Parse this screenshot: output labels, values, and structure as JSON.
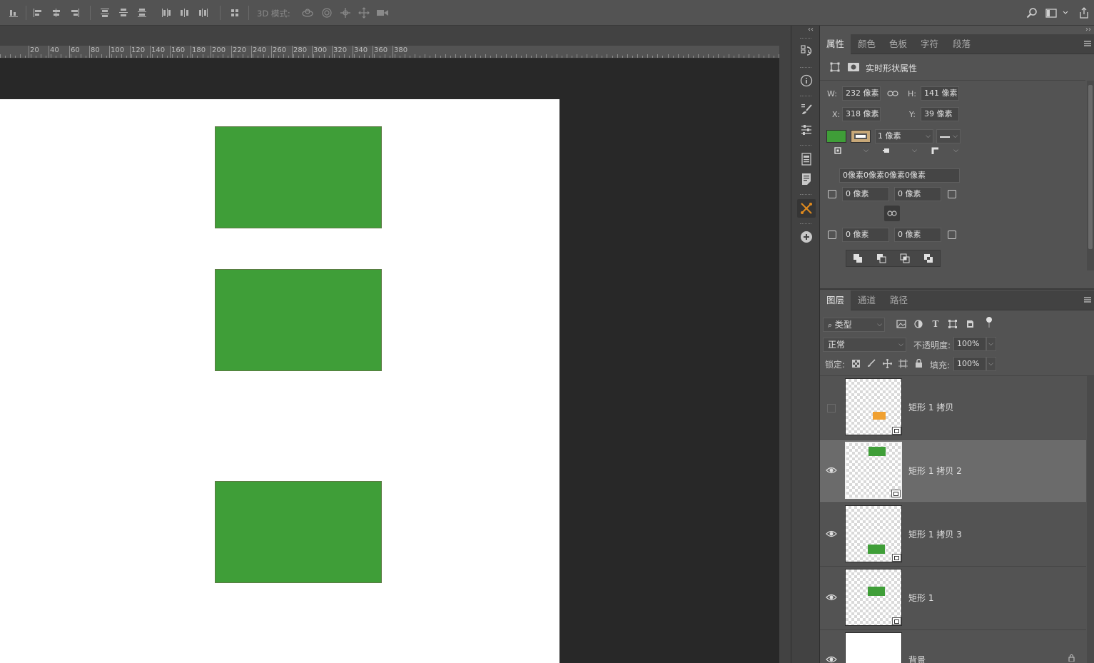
{
  "toolbar": {
    "mode_label": "3D 模式:"
  },
  "ruler": {
    "labels": [
      "20",
      "40",
      "60",
      "80",
      "100",
      "120",
      "140",
      "160",
      "180",
      "200",
      "220",
      "240",
      "260",
      "280",
      "300",
      "320",
      "340",
      "360",
      "380"
    ]
  },
  "canvas": {
    "shape_color": "#3f9e38"
  },
  "properties_panel": {
    "tabs": [
      "属性",
      "颜色",
      "色板",
      "字符",
      "段落"
    ],
    "active_tab": "属性",
    "header_label": "实时形状属性",
    "w_label": "W:",
    "w_value": "232 像素",
    "h_label": "H:",
    "h_value": "141 像素",
    "x_label": "X:",
    "x_value": "318 像素",
    "y_label": "Y:",
    "y_value": "39 像素",
    "fill_color": "#3f9e38",
    "stroke_color": "#c8a878",
    "stroke_width": "1 像素",
    "corner_all": "0像素0像素0像素0像素",
    "corner_tl": "0 像素",
    "corner_tr": "0 像素",
    "corner_bl": "0 像素",
    "corner_br": "0 像素"
  },
  "layers_panel": {
    "tabs": [
      "图层",
      "通道",
      "路径"
    ],
    "active_tab": "图层",
    "filter_label": "类型",
    "blend_mode": "正常",
    "opacity_label": "不透明度:",
    "opacity_value": "100%",
    "lock_label": "锁定:",
    "fill_label": "填充:",
    "fill_value": "100%",
    "layers": [
      {
        "name": "矩形 1 拷贝",
        "visible": false,
        "selected": false,
        "thumb_color": "#f0a030"
      },
      {
        "name": "矩形 1 拷贝 2",
        "visible": true,
        "selected": true,
        "thumb_color": "#3f9e38"
      },
      {
        "name": "矩形 1 拷贝 3",
        "visible": true,
        "selected": false,
        "thumb_color": "#3f9e38"
      },
      {
        "name": "矩形 1",
        "visible": true,
        "selected": false,
        "thumb_color": "#3f9e38"
      },
      {
        "name": "背景",
        "visible": true,
        "selected": false,
        "thumb_color": "#ffffff"
      }
    ]
  }
}
